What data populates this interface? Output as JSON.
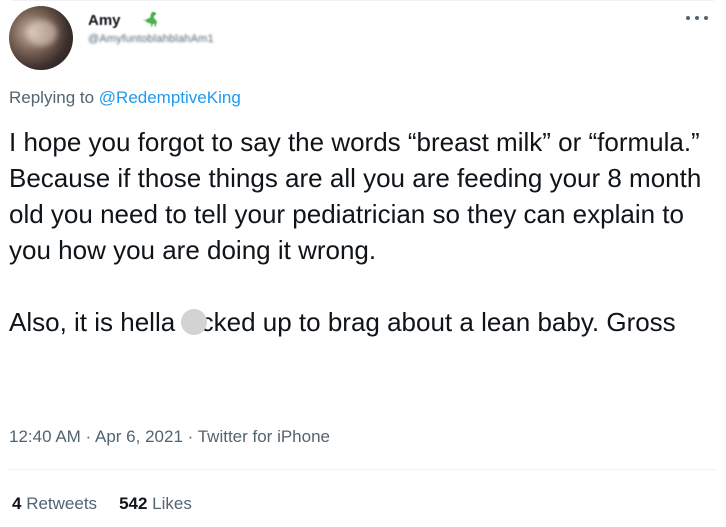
{
  "user": {
    "display_name": "Amy",
    "handle": "@AmyfuntoblahblahAm1",
    "name_emoji": "dinosaur"
  },
  "reply": {
    "prefix": "Replying to ",
    "to": "@RedemptiveKing"
  },
  "tweet": {
    "para1": "I hope you forgot to say the words “breast milk” or “formula.” Because if those things are all you are feeding your 8 month old you need to tell your pediatrician so they can explain to you how you are doing it wrong.",
    "para2_before": "Also, it is hella f",
    "para2_after": "cked up to brag about a lean baby. Gross"
  },
  "meta": {
    "time": "12:40 AM",
    "sep": " · ",
    "date": "Apr 6, 2021",
    "source": "Twitter for iPhone"
  },
  "stats": {
    "retweets_count": "4",
    "retweets_label": " Retweets",
    "likes_count": "542",
    "likes_label": " Likes"
  },
  "colors": {
    "accent": "#1d9bf0",
    "text": "#0f1419",
    "secondary": "#536471",
    "censor": "#d3d3d3"
  }
}
